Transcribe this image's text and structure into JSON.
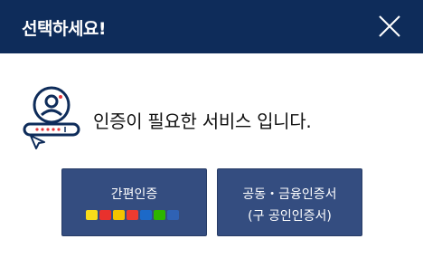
{
  "dialog": {
    "title": "선택하세요!",
    "message": "인증이 필요한 서비스 입니다.",
    "buttons": {
      "simple_auth": {
        "label": "간편인증"
      },
      "joint_cert": {
        "line1": "공동・금융인증서",
        "line2": "(구 공인인증서)"
      }
    },
    "provider_logos": [
      {
        "icon": "kakao-logo-icon",
        "color": "#f9dd1a"
      },
      {
        "icon": "payco-logo-icon",
        "color": "#e8312d"
      },
      {
        "icon": "kb-logo-icon",
        "color": "#f3c400"
      },
      {
        "icon": "samsung-pass-logo-icon",
        "color": "#ee3b2f"
      },
      {
        "icon": "toss-logo-icon",
        "color": "#1c69c8"
      },
      {
        "icon": "naver-logo-icon",
        "color": "#2db400"
      },
      {
        "icon": "shinhan-logo-icon",
        "color": "#2f62b5"
      }
    ],
    "colors": {
      "header_bg": "#0e2c5a",
      "button_bg": "#344d80",
      "accent_red": "#e8383d"
    }
  }
}
